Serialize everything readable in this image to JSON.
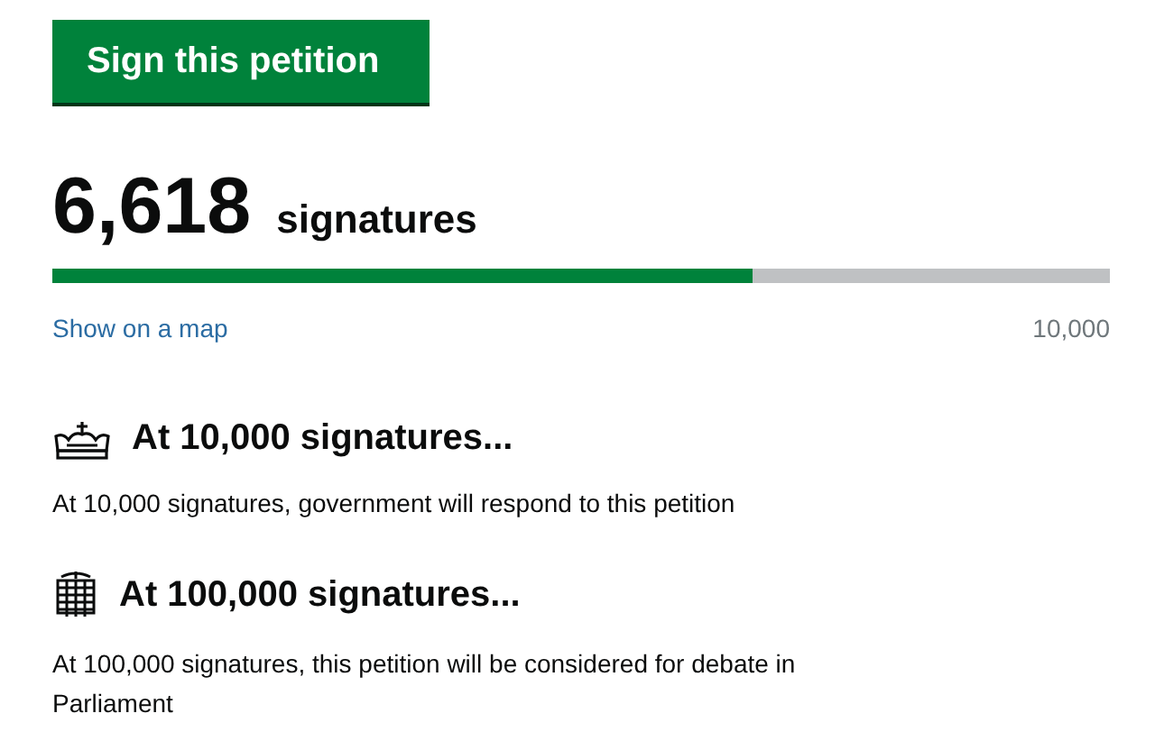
{
  "sign_button": "Sign this petition",
  "count": {
    "number": "6,618",
    "label": "signatures"
  },
  "progress": {
    "level": 0.662,
    "link": "Show on a map",
    "target": "10,000"
  },
  "milestones": [
    {
      "kind": "crown",
      "title": "At 10,000 signatures...",
      "text": "At 10,000 signatures, government will respond to this petition"
    },
    {
      "kind": "portcullis",
      "title": "At 100,000 signatures...",
      "text": "At 100,000 signatures, this petition will be considered for debate in Parliament"
    }
  ]
}
